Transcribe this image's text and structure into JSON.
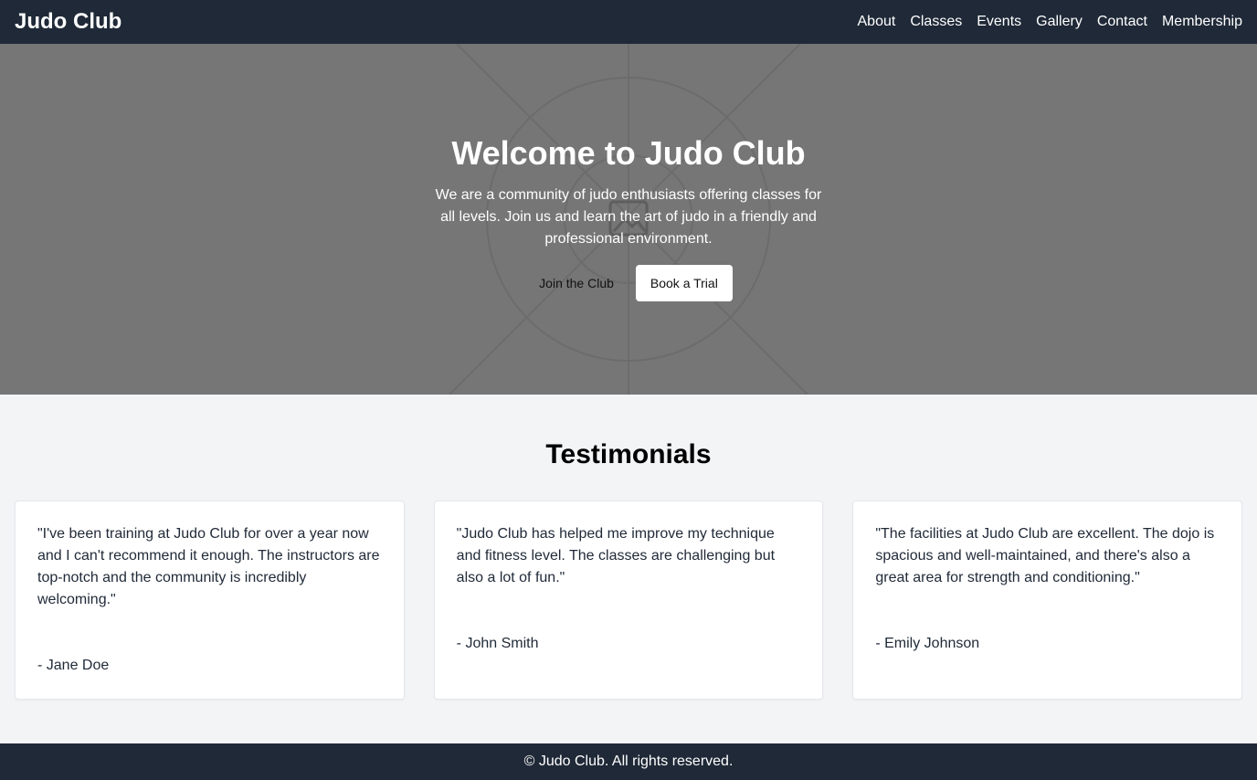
{
  "nav": {
    "brand": "Judo Club",
    "links": [
      "About",
      "Classes",
      "Events",
      "Gallery",
      "Contact",
      "Membership"
    ]
  },
  "hero": {
    "title": "Welcome to Judo Club",
    "text": "We are a community of judo enthusiasts offering classes for all levels. Join us and learn the art of judo in a friendly and professional environment.",
    "primary_button": "Join the Club",
    "secondary_button": "Book a Trial",
    "background_color": "#767676"
  },
  "testimonials": {
    "title": "Testimonials",
    "items": [
      {
        "quote": "\"I've been training at Judo Club for over a year now and I can't recommend it enough. The instructors are top-notch and the community is incredibly welcoming.\"",
        "author": "- Jane Doe"
      },
      {
        "quote": "\"Judo Club has helped me improve my technique and fitness level. The classes are challenging but also a lot of fun.\"",
        "author": "- John Smith"
      },
      {
        "quote": "\"The facilities at Judo Club are excellent. The dojo is spacious and well-maintained, and there's also a great area for strength and conditioning.\"",
        "author": "- Emily Johnson"
      }
    ]
  },
  "footer": {
    "text": "© Judo Club. All rights reserved."
  },
  "colors": {
    "navbar": "#1f2937",
    "page_background": "#f3f4f6",
    "card_background": "#ffffff"
  }
}
